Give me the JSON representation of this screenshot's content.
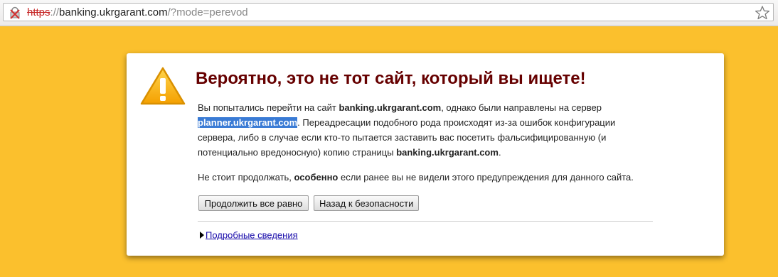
{
  "browser": {
    "url_scheme": "https",
    "url_separator": "://",
    "url_host": "banking.ukrgarant.com",
    "url_path": "/?mode=perevod"
  },
  "interstitial": {
    "title": "Вероятно, это не тот сайт, который вы ищете!",
    "body": {
      "part1": "Вы попытались перейти на сайт ",
      "requested_host": "banking.ukrgarant.com",
      "part2": ", однако были направлены на сервер ",
      "redirect_host": "planner.ukrgarant.com",
      "part3": ". Переадресации подобного рода происходят из-за ошибок конфигурации сервера, либо в случае если кто-то пытается заставить вас посетить фальсифицированную (и потенциально вредоносную) копию страницы ",
      "requested_host_again": "banking.ukrgarant.com",
      "part4": "."
    },
    "advice": {
      "part1": "Не стоит продолжать, ",
      "emphasis": "особенно",
      "part2": " если ранее вы не видели этого предупреждения для данного сайта."
    },
    "proceed_label": "Продолжить все равно",
    "back_label": "Назад к безопасности",
    "details_label": "Подробные сведения"
  },
  "colors": {
    "page_background": "#fbc02d",
    "title": "#660000",
    "selection": "#3a7bd5",
    "insecure_scheme": "#c62828",
    "link": "#1a0dab"
  },
  "icons": {
    "address_bar": "lock-broken-icon",
    "bookmark": "star-icon",
    "warning": "warning-icon",
    "expander": "triangle-right-icon"
  }
}
